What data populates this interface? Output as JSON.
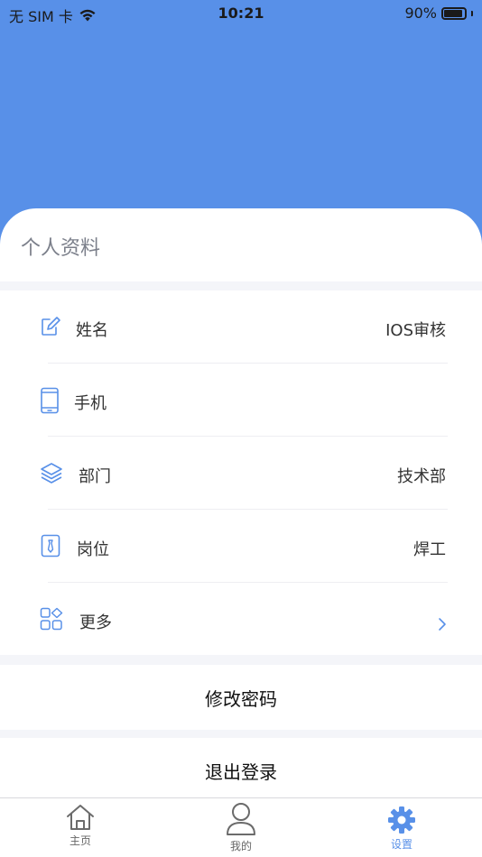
{
  "status": {
    "carrier": "无 SIM 卡",
    "time": "10:21",
    "battery": "90%",
    "battery_level": 0.9
  },
  "profile": {
    "title": "个人资料",
    "rows": [
      {
        "label": "姓名",
        "value": "IOS审核",
        "icon": "edit-icon"
      },
      {
        "label": "手机",
        "value": "",
        "icon": "phone-icon"
      },
      {
        "label": "部门",
        "value": "技术部",
        "icon": "layers-icon"
      },
      {
        "label": "岗位",
        "value": "焊工",
        "icon": "badge-icon"
      },
      {
        "label": "更多",
        "value": "",
        "icon": "apps-icon"
      }
    ]
  },
  "actions": {
    "change_password": "修改密码",
    "logout": "退出登录"
  },
  "tabbar": {
    "home": "主页",
    "mine": "我的",
    "settings": "设置"
  },
  "colors": {
    "accent": "#5890e8",
    "background": "#f4f5f9"
  }
}
